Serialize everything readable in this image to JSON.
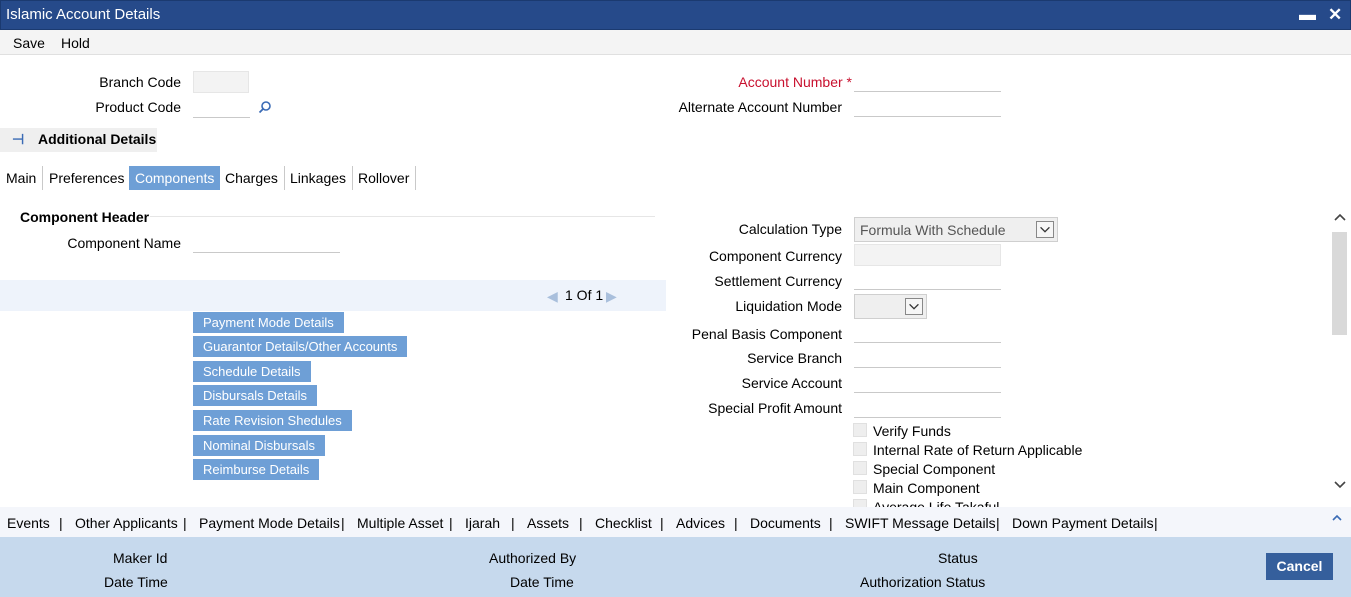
{
  "window": {
    "title": "Islamic Account Details"
  },
  "toolbar": {
    "save": "Save",
    "hold": "Hold"
  },
  "form": {
    "branch_code_label": "Branch Code",
    "product_code_label": "Product Code",
    "account_number_label": "Account Number",
    "required_marker": "*",
    "alternate_account_label": "Alternate Account Number"
  },
  "section": {
    "title": "Additional Details"
  },
  "tabs": [
    "Main",
    "Preferences",
    "Components",
    "Charges",
    "Linkages",
    "Rollover"
  ],
  "active_tab": "Components",
  "component": {
    "header": "Component Header",
    "name_label": "Component Name",
    "pager": "1 Of  1"
  },
  "buttons": [
    "Payment Mode Details",
    "Guarantor Details/Other Accounts",
    "Schedule Details",
    "Disbursals Details",
    "Rate Revision Shedules",
    "Nominal Disbursals",
    "Reimburse Details"
  ],
  "right_fields": {
    "calculation_type_label": "Calculation Type",
    "calculation_type_value": "Formula With Schedule",
    "component_currency_label": "Component Currency",
    "settlement_currency_label": "Settlement Currency",
    "liquidation_mode_label": "Liquidation Mode",
    "penal_basis_label": "Penal Basis Component",
    "service_branch_label": "Service Branch",
    "service_account_label": "Service Account",
    "special_profit_label": "Special Profit Amount"
  },
  "checkboxes": [
    "Verify Funds",
    "Internal Rate of Return Applicable",
    "Special Component",
    "Main Component",
    "Average Life Takaful"
  ],
  "footer_links": [
    "Events",
    "Other Applicants",
    "Payment Mode Details",
    "Multiple Asset",
    "Ijarah",
    "Assets",
    "Checklist",
    "Advices",
    "Documents",
    "SWIFT Message Details",
    "Down Payment Details"
  ],
  "status": {
    "maker_id": "Maker Id",
    "date_time": "Date Time",
    "authorized_by": "Authorized By",
    "status": "Status",
    "authorization_status": "Authorization Status",
    "cancel": "Cancel"
  },
  "icons": {
    "minimize": "minimize-icon",
    "close": "close-icon",
    "search": "search-icon",
    "collapse": "collapse-icon",
    "prev": "prev-page-icon",
    "next": "next-page-icon",
    "dropdown": "chevron-down-icon"
  },
  "colors": {
    "titlebar": "#264a8a",
    "accent": "#6e9fd6",
    "required": "#c8102e",
    "statusbar": "#c6d9ed",
    "cancel": "#355f9c"
  }
}
